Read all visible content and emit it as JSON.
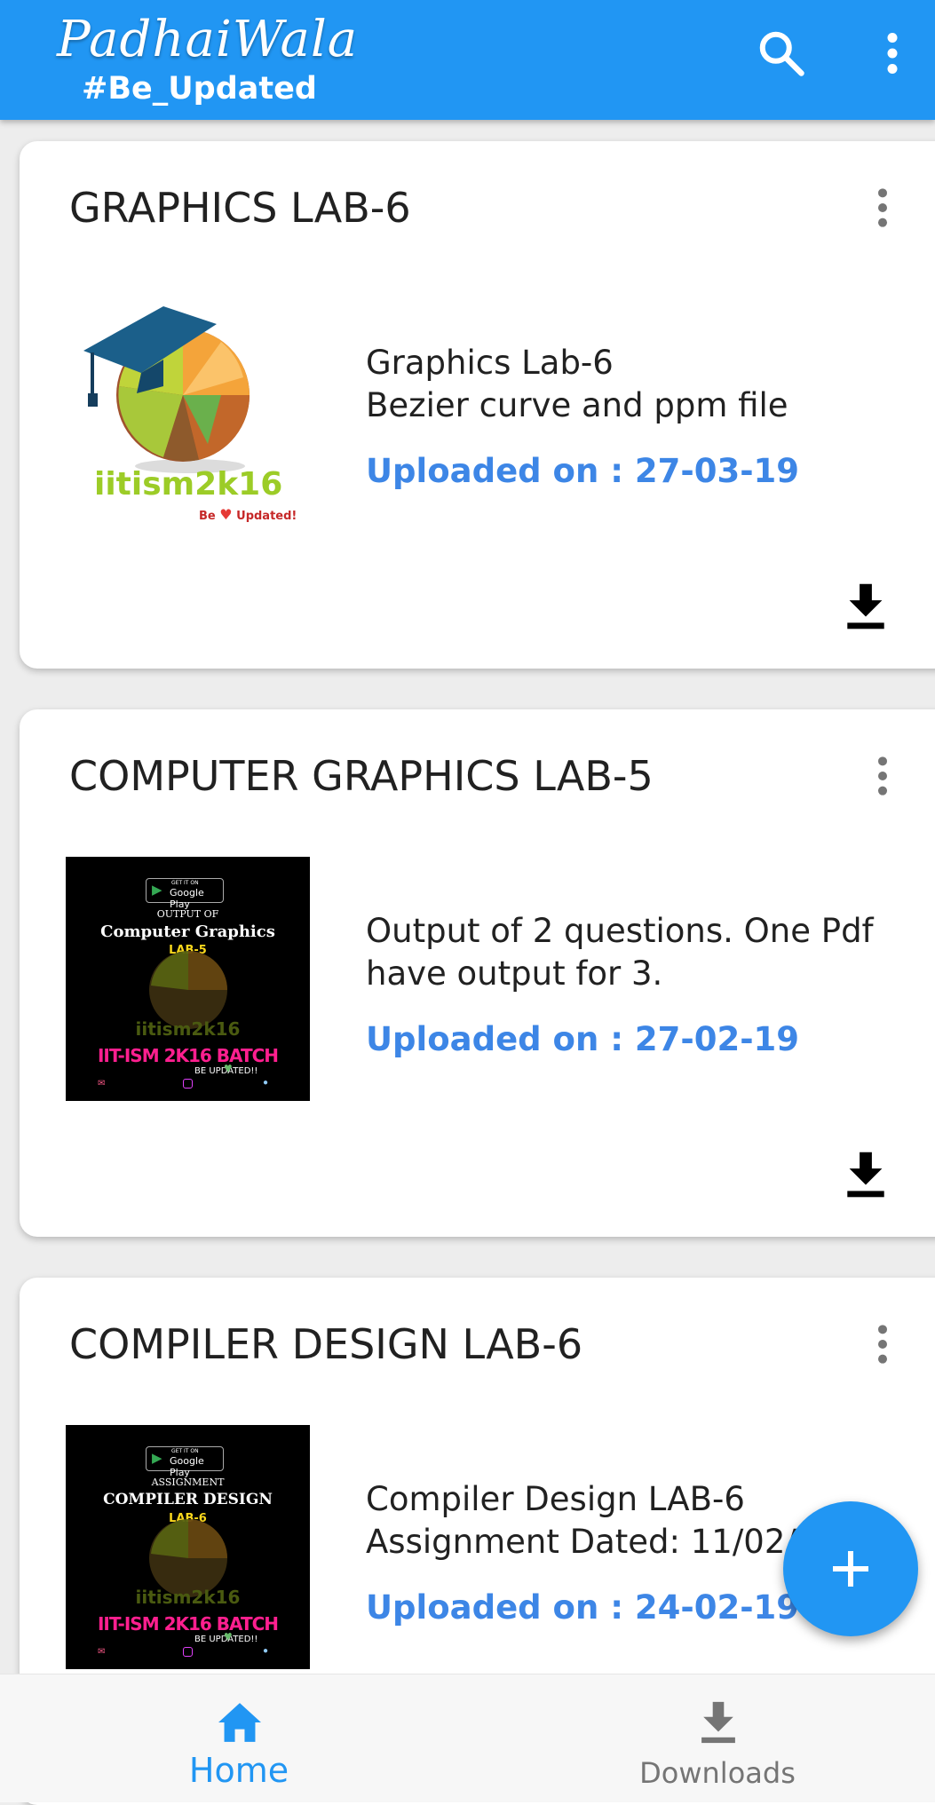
{
  "appbar": {
    "title": "PadhaiWala",
    "tagline": "#Be_Updated",
    "color": "#2196f3",
    "icons": [
      "search-icon",
      "more-vert-icon"
    ]
  },
  "cards": [
    {
      "title": "GRAPHICS LAB-6",
      "description": "Graphics Lab-6\nBezier curve and ppm file",
      "uploaded": "Uploaded on : 27-03-19",
      "thumbnail": {
        "type": "logo",
        "brand": "iitism2k16",
        "slogan_be": "Be",
        "slogan_updated": "Updated!"
      }
    },
    {
      "title": "COMPUTER GRAPHICS LAB-5",
      "description": "Output of 2 questions. One Pdf have output for 3.",
      "uploaded": "Uploaded on : 27-02-19",
      "thumbnail": {
        "type": "poster",
        "store_small": "GET IT ON",
        "store": "Google Play",
        "kicker": "OUTPUT OF",
        "headline": "Computer Graphics",
        "sub": "LAB-5",
        "brand": "iitism2k16",
        "batch": "IIT-ISM 2K16 BATCH",
        "slogan": "BE UPDATED!!"
      }
    },
    {
      "title": "COMPILER DESIGN LAB-6",
      "description": "Compiler Design LAB-6\nAssignment Dated: 11/02/",
      "uploaded": "Uploaded on : 24-02-19",
      "thumbnail": {
        "type": "poster",
        "store_small": "GET IT ON",
        "store": "Google Play",
        "kicker": "ASSIGNMENT",
        "headline": "COMPILER DESIGN",
        "sub": "LAB-6",
        "brand": "iitism2k16",
        "batch": "IIT-ISM 2K16 BATCH",
        "slogan": "BE UPDATED!!"
      }
    }
  ],
  "fab": {
    "icon": "plus-icon",
    "color": "#2196f3"
  },
  "bottom_nav": {
    "items": [
      {
        "label": "Home",
        "icon": "home-icon",
        "active": true,
        "color": "#2196f3"
      },
      {
        "label": "Downloads",
        "icon": "download-icon",
        "active": false,
        "color": "#757575"
      }
    ]
  }
}
